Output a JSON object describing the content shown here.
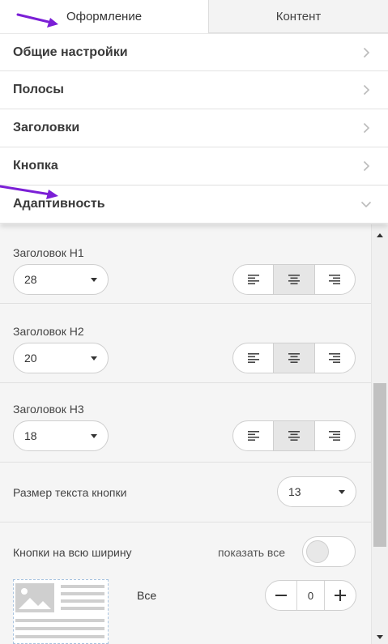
{
  "tabs": [
    {
      "label": "Оформление",
      "active": true
    },
    {
      "label": "Контент",
      "active": false
    }
  ],
  "accordion": [
    {
      "label": "Общие настройки",
      "icon": "chevron-right-icon"
    },
    {
      "label": "Полосы",
      "icon": "chevron-right-icon"
    },
    {
      "label": "Заголовки",
      "icon": "chevron-right-icon"
    },
    {
      "label": "Кнопка",
      "icon": "chevron-right-icon"
    },
    {
      "label": "Адаптивность",
      "icon": "chevron-down-icon",
      "expanded": true
    }
  ],
  "headings": [
    {
      "title": "Заголовок H1",
      "size": "28",
      "align": "center"
    },
    {
      "title": "Заголовок H2",
      "size": "20",
      "align": "center"
    },
    {
      "title": "Заголовок H3",
      "size": "18",
      "align": "center"
    }
  ],
  "button_text": {
    "label": "Размер текста кнопки",
    "size": "13"
  },
  "full_width": {
    "label": "Кнопки на всю ширину",
    "toggle_label": "показать все",
    "toggle_on": false,
    "row_label": "Все",
    "stepper_value": "0",
    "minus": "−",
    "plus": "+"
  },
  "colors": {
    "annotation_arrow": "#7b1fd6",
    "panel_bg": "#f5f5f5",
    "selected_align_bg": "#e6e6e6"
  }
}
